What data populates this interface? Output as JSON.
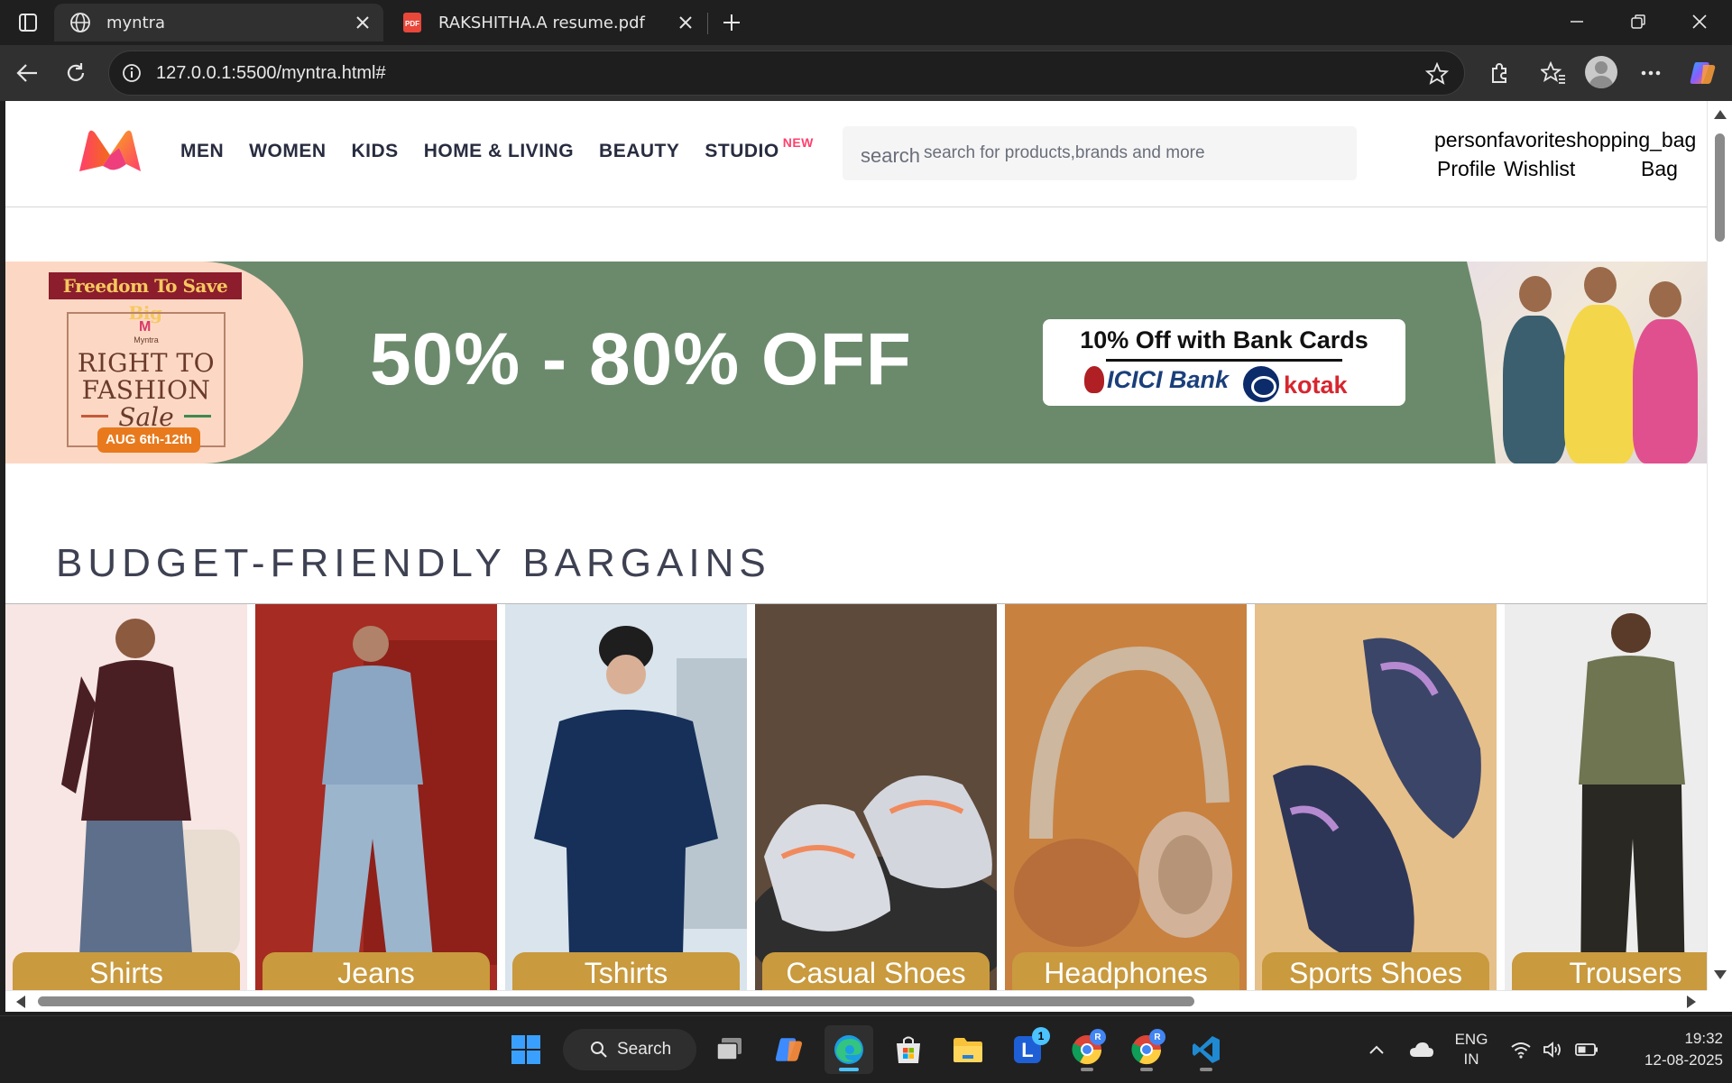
{
  "browser": {
    "tabs": [
      {
        "title": "myntra",
        "icon": "globe-icon",
        "active": true
      },
      {
        "title": "RAKSHITHA.A resume.pdf",
        "icon": "pdf-icon",
        "active": false
      }
    ],
    "url": "127.0.0.1:5500/myntra.html#",
    "accent": "#4cc2ff"
  },
  "header": {
    "nav": [
      "MEN",
      "WOMEN",
      "KIDS",
      "HOME & LIVING",
      "BEAUTY",
      "STUDIO"
    ],
    "studio_badge": "NEW",
    "search": {
      "icon_text": "search",
      "placeholder": "search for products,brands and more",
      "value": ""
    },
    "actions": {
      "icon_ligatures": "personfavoriteshopping_bag",
      "profile_label": "Profile",
      "wishlist_label": "Wishlist",
      "bag_label": "Bag"
    },
    "brand_colors": {
      "pink": "#ff3f6c",
      "orange": "#f26a10",
      "text": "#282c3f"
    }
  },
  "banner": {
    "tagline": "Freedom To Save Big",
    "brand_small": "Myntra",
    "campaign_line1": "RIGHT TO",
    "campaign_line2": "FASHION",
    "campaign_sale": "Sale",
    "dates": "AUG 6th-12th",
    "offer": "50% - 80% OFF",
    "bank_offer": "10% Off with Bank Cards",
    "bank1": "ICICI Bank",
    "bank2": "kotak",
    "background_color": "#6b8a6c"
  },
  "section": {
    "title": "BUDGET-FRIENDLY BARGAINS",
    "cards": [
      {
        "label": "Shirts"
      },
      {
        "label": "Jeans"
      },
      {
        "label": "Tshirts"
      },
      {
        "label": "Casual Shoes"
      },
      {
        "label": "Headphones"
      },
      {
        "label": "Sports Shoes"
      },
      {
        "label": "Trousers"
      }
    ]
  },
  "taskbar": {
    "search_label": "Search",
    "badge_count": "1",
    "profile_badge": "R",
    "language_line1": "ENG",
    "language_line2": "IN",
    "time": "19:32",
    "date": "12-08-2025"
  }
}
